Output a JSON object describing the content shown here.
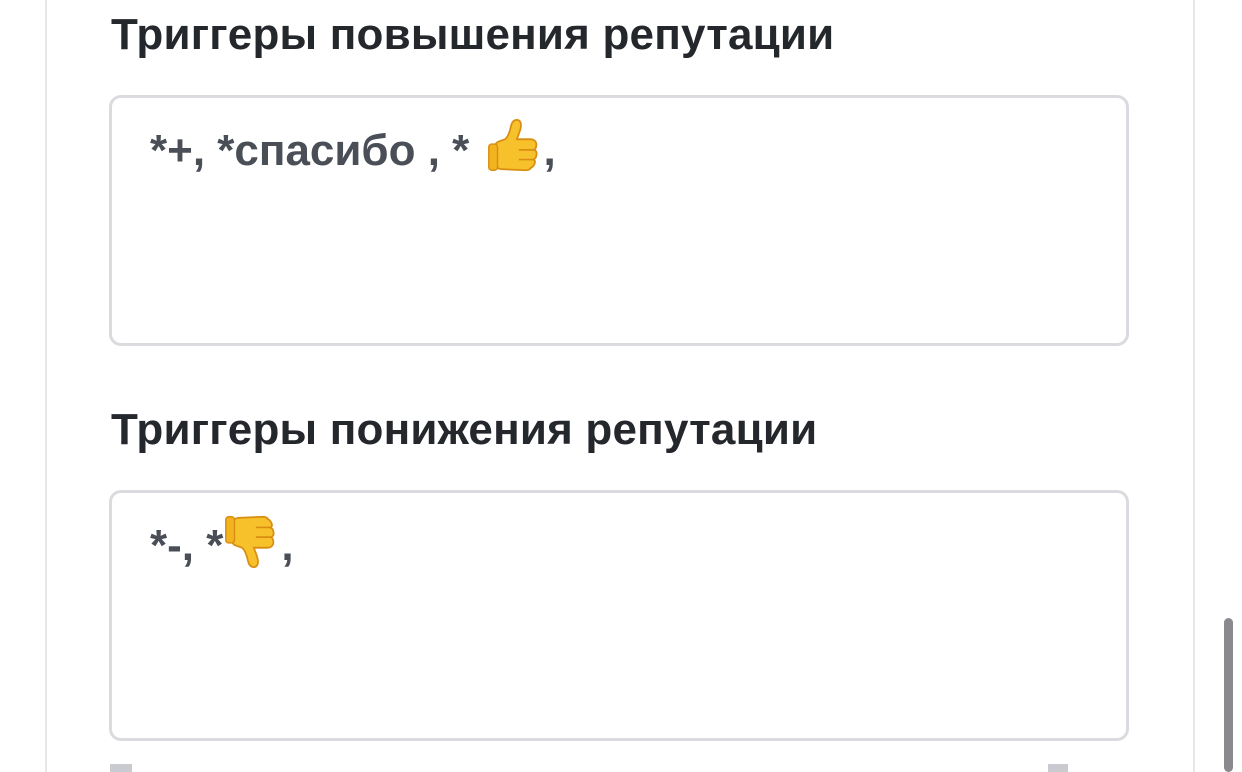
{
  "sections": [
    {
      "title": "Триггеры повышения репутации",
      "value": "*+, *спасибо , * 👍,",
      "text_before_icon": "*+, *спасибо , * ",
      "icon": "thumbs-up-icon",
      "text_after_icon": ","
    },
    {
      "title": "Триггеры понижения репутации",
      "value": "*-, *👎,",
      "text_before_icon": "*-, *",
      "icon": "thumbs-down-icon",
      "text_after_icon": ","
    }
  ],
  "colors": {
    "title": "#24272c",
    "field_text": "#4a4f57",
    "field_border": "#d9dbde",
    "page_border": "#e6e7e9",
    "scrollbar": "#8a8a8e",
    "emoji": "#f7c12b"
  }
}
